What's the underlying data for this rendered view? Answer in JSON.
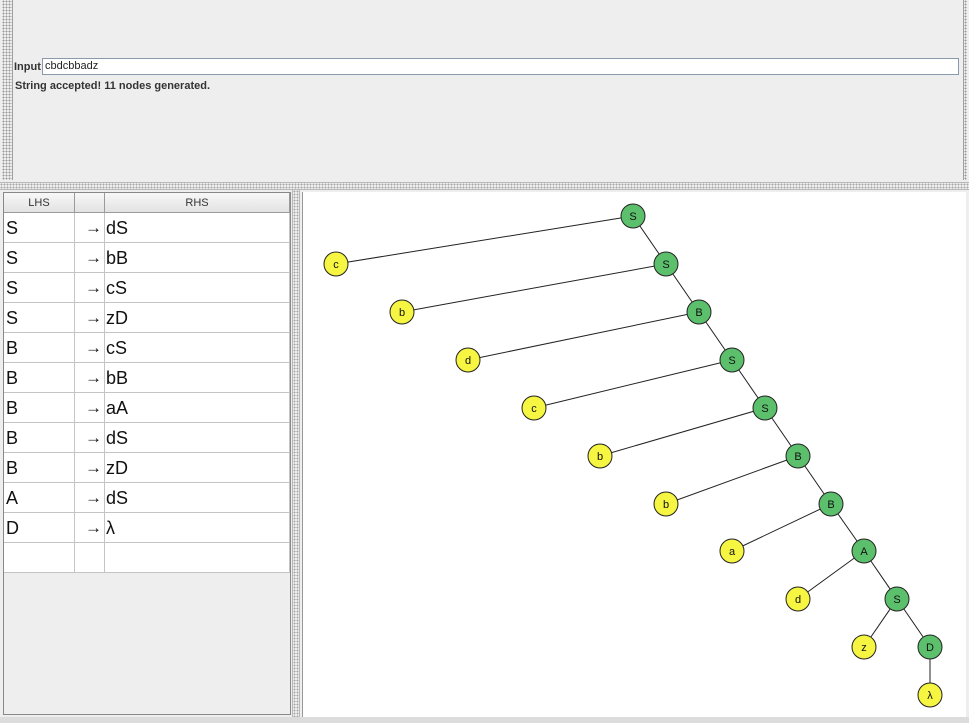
{
  "input": {
    "label": "Input",
    "value": "cbdcbbadz"
  },
  "status": "String accepted!  11 nodes generated.",
  "grammar_table": {
    "headers": {
      "lhs": "LHS",
      "arrow": "",
      "rhs": "RHS"
    },
    "rows": [
      {
        "lhs": "S",
        "arrow": "→",
        "rhs": "dS"
      },
      {
        "lhs": "S",
        "arrow": "→",
        "rhs": "bB"
      },
      {
        "lhs": "S",
        "arrow": "→",
        "rhs": "cS"
      },
      {
        "lhs": "S",
        "arrow": "→",
        "rhs": "zD"
      },
      {
        "lhs": "B",
        "arrow": "→",
        "rhs": "cS"
      },
      {
        "lhs": "B",
        "arrow": "→",
        "rhs": "bB"
      },
      {
        "lhs": "B",
        "arrow": "→",
        "rhs": "aA"
      },
      {
        "lhs": "B",
        "arrow": "→",
        "rhs": "dS"
      },
      {
        "lhs": "B",
        "arrow": "→",
        "rhs": "zD"
      },
      {
        "lhs": "A",
        "arrow": "→",
        "rhs": "dS"
      },
      {
        "lhs": "D",
        "arrow": "→",
        "rhs": "λ"
      },
      {
        "lhs": "",
        "arrow": "",
        "rhs": ""
      }
    ]
  },
  "parse_tree": {
    "colors": {
      "variable": "#5cbf6c",
      "terminal": "#f5f542",
      "stroke": "#222222"
    },
    "nodes": [
      {
        "id": "n0",
        "label": "S",
        "kind": "variable"
      },
      {
        "id": "t0",
        "label": "c",
        "kind": "terminal"
      },
      {
        "id": "n1",
        "label": "S",
        "kind": "variable"
      },
      {
        "id": "t1",
        "label": "b",
        "kind": "terminal"
      },
      {
        "id": "n2",
        "label": "B",
        "kind": "variable"
      },
      {
        "id": "t2",
        "label": "d",
        "kind": "terminal"
      },
      {
        "id": "n3",
        "label": "S",
        "kind": "variable"
      },
      {
        "id": "t3",
        "label": "c",
        "kind": "terminal"
      },
      {
        "id": "n4",
        "label": "S",
        "kind": "variable"
      },
      {
        "id": "t4",
        "label": "b",
        "kind": "terminal"
      },
      {
        "id": "n5",
        "label": "B",
        "kind": "variable"
      },
      {
        "id": "t5",
        "label": "b",
        "kind": "terminal"
      },
      {
        "id": "n6",
        "label": "B",
        "kind": "variable"
      },
      {
        "id": "t6",
        "label": "a",
        "kind": "terminal"
      },
      {
        "id": "n7",
        "label": "A",
        "kind": "variable"
      },
      {
        "id": "t7",
        "label": "d",
        "kind": "terminal"
      },
      {
        "id": "n8",
        "label": "S",
        "kind": "variable"
      },
      {
        "id": "t8",
        "label": "z",
        "kind": "terminal"
      },
      {
        "id": "n9",
        "label": "D",
        "kind": "variable"
      },
      {
        "id": "t9",
        "label": "λ",
        "kind": "terminal"
      }
    ],
    "edges": [
      [
        "n0",
        "t0"
      ],
      [
        "n0",
        "n1"
      ],
      [
        "n1",
        "t1"
      ],
      [
        "n1",
        "n2"
      ],
      [
        "n2",
        "t2"
      ],
      [
        "n2",
        "n3"
      ],
      [
        "n3",
        "t3"
      ],
      [
        "n3",
        "n4"
      ],
      [
        "n4",
        "t4"
      ],
      [
        "n4",
        "n5"
      ],
      [
        "n5",
        "t5"
      ],
      [
        "n5",
        "n6"
      ],
      [
        "n6",
        "t6"
      ],
      [
        "n6",
        "n7"
      ],
      [
        "n7",
        "t7"
      ],
      [
        "n7",
        "n8"
      ],
      [
        "n8",
        "t8"
      ],
      [
        "n8",
        "n9"
      ],
      [
        "n9",
        "t9"
      ]
    ]
  }
}
